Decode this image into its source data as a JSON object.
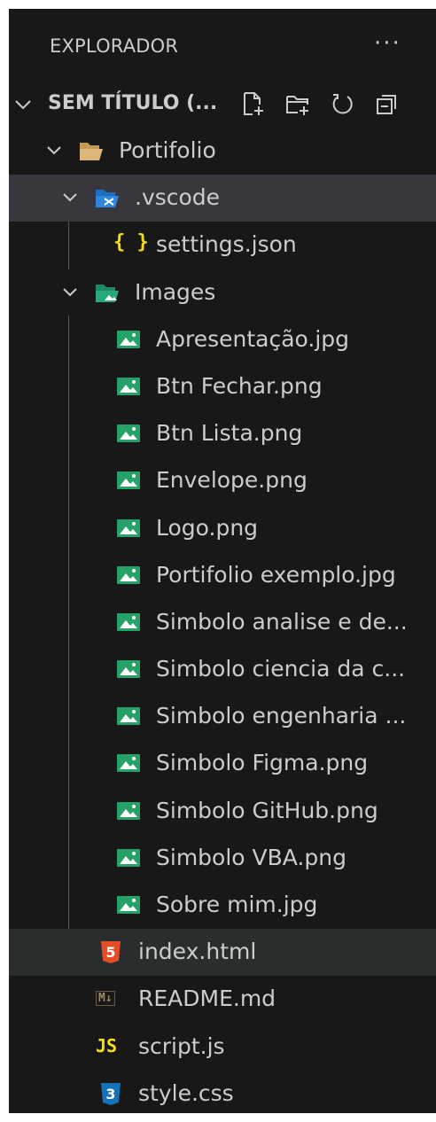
{
  "explorer": {
    "title": "EXPLORADOR",
    "more_label": "···"
  },
  "workspace": {
    "title": "SEM TÍTULO (...",
    "actions": [
      "new-file-icon",
      "new-folder-icon",
      "refresh-icon",
      "collapse-all-icon"
    ]
  },
  "tree": {
    "root": "Portifolio",
    "vscode_folder": ".vscode",
    "settings_file": "settings.json",
    "images_folder": "Images",
    "images": [
      "Apresentação.jpg",
      "Btn Fechar.png",
      "Btn Lista.png",
      "Envelope.png",
      "Logo.png",
      "Portifolio exemplo.jpg",
      "Simbolo analise e de...",
      "Simbolo ciencia da c...",
      "Simbolo engenharia ...",
      "Simbolo Figma.png",
      "Simbolo GitHub.png",
      "Simbolo VBA.png",
      "Sobre mim.jpg"
    ],
    "index_file": "index.html",
    "readme_file": "README.md",
    "script_file": "script.js",
    "style_file": "style.css",
    "icon_text": {
      "json": "{ }",
      "html": "5",
      "markdown": "M↓",
      "js": "JS",
      "css": "3"
    }
  },
  "colors": {
    "background": "#181818",
    "text": "#cccccc",
    "selection": "#37373d",
    "hover": "#2a2d2e",
    "folder": "#dcb67a",
    "vscode_folder": "#2e86de",
    "images_folder": "#2aaa7a",
    "image_file": "#26a269",
    "json": "#f5de19",
    "html": "#e44d26",
    "js": "#f5de19",
    "css": "#1572b6"
  }
}
